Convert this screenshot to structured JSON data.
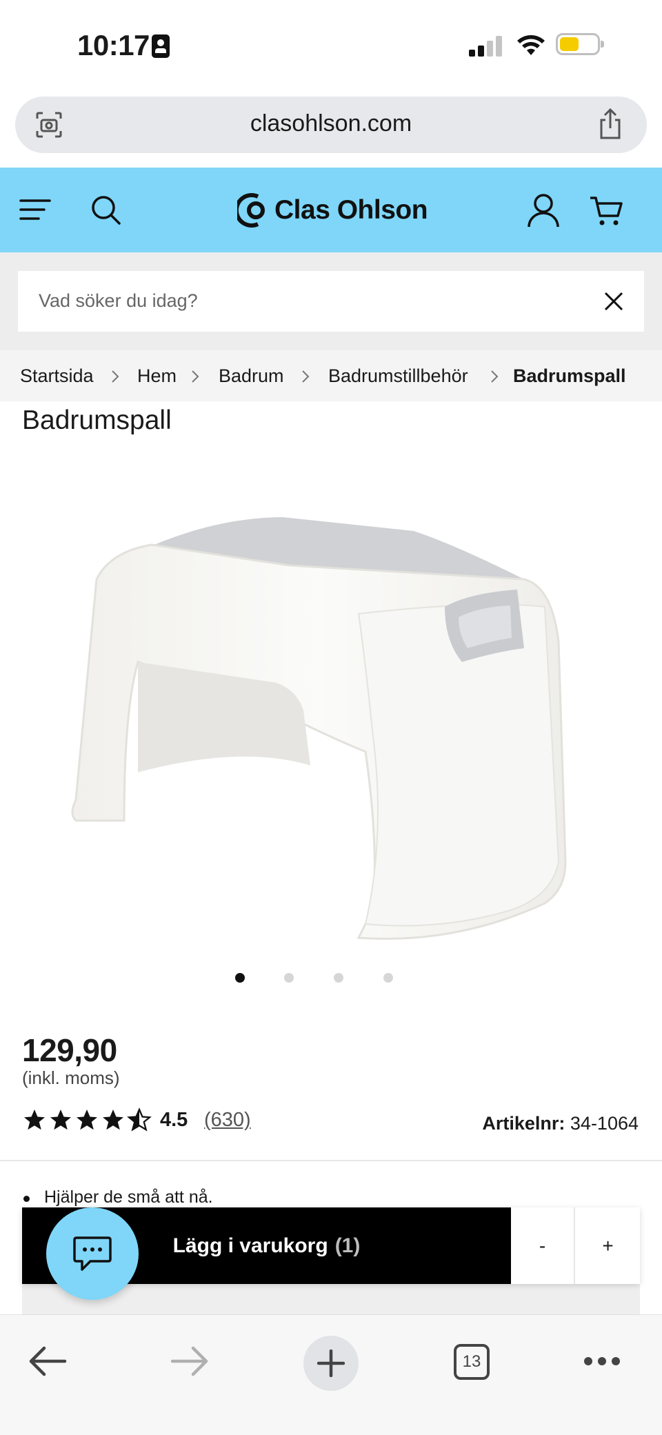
{
  "status_bar": {
    "time": "10:17"
  },
  "browser": {
    "url": "clasohlson.com",
    "tab_count": "13"
  },
  "header": {
    "logo_text": "Clas Ohlson",
    "accent_color": "#7fd6f8"
  },
  "search": {
    "placeholder": "Vad söker du idag?"
  },
  "breadcrumb": {
    "items": [
      "Startsida",
      "Hem",
      "Badrum",
      "Badrumstillbehör",
      "Badrumspall"
    ]
  },
  "product": {
    "title": "Badrumspall",
    "image_count": 4,
    "active_image": 1,
    "price": "129,90",
    "vat_note": "(inkl. moms)",
    "rating": 4.5,
    "rating_text": "4.5",
    "review_count": "(630)",
    "article_label": "Artikelnr:",
    "article_number": "34-1064",
    "bullets": [
      "Hjälper de små att nå."
    ]
  },
  "cart": {
    "add_label": "Lägg i varukorg",
    "quantity": "(1)",
    "minus_label": "-",
    "plus_label": "+"
  },
  "icons": {
    "menu": "menu-icon",
    "search": "search-icon",
    "user": "user-icon",
    "cart": "cart-icon",
    "chat": "chat-icon"
  }
}
